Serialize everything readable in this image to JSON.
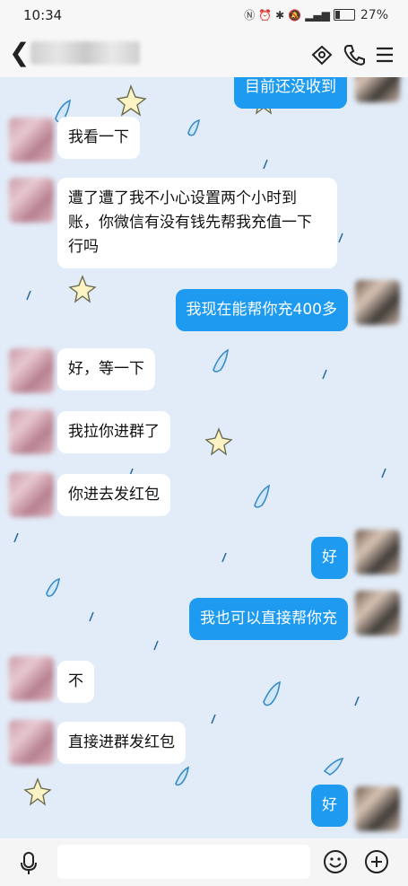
{
  "status_bar": {
    "time": "10:34",
    "battery": "27%",
    "battery_level": 0.27,
    "icons": [
      "nfc-icon",
      "alarm-icon",
      "bluetooth-icon",
      "mute-icon",
      "signal-icon",
      "battery-icon"
    ]
  },
  "header": {
    "icons": [
      "back-icon",
      "home-icon",
      "phone-icon",
      "menu-icon"
    ]
  },
  "messages": [
    {
      "side": "out",
      "text": "目前还没收到"
    },
    {
      "side": "in",
      "text": "我看一下"
    },
    {
      "side": "in",
      "text": "遭了遭了我不小心设置两个小时到账，你微信有没有钱先帮我充值一下行吗"
    },
    {
      "side": "out",
      "text": "我现在能帮你充400多"
    },
    {
      "side": "in",
      "text": "好，等一下"
    },
    {
      "side": "in",
      "text": "我拉你进群了"
    },
    {
      "side": "in",
      "text": "你进去发红包"
    },
    {
      "side": "out",
      "text": "好"
    },
    {
      "side": "out",
      "text": "我也可以直接帮你充"
    },
    {
      "side": "in",
      "text": "不"
    },
    {
      "side": "in",
      "text": "直接进群发红包"
    },
    {
      "side": "out",
      "text": "好"
    }
  ],
  "input_bar": {
    "icons": [
      "voice-icon",
      "emoji-icon",
      "plus-icon"
    ]
  }
}
